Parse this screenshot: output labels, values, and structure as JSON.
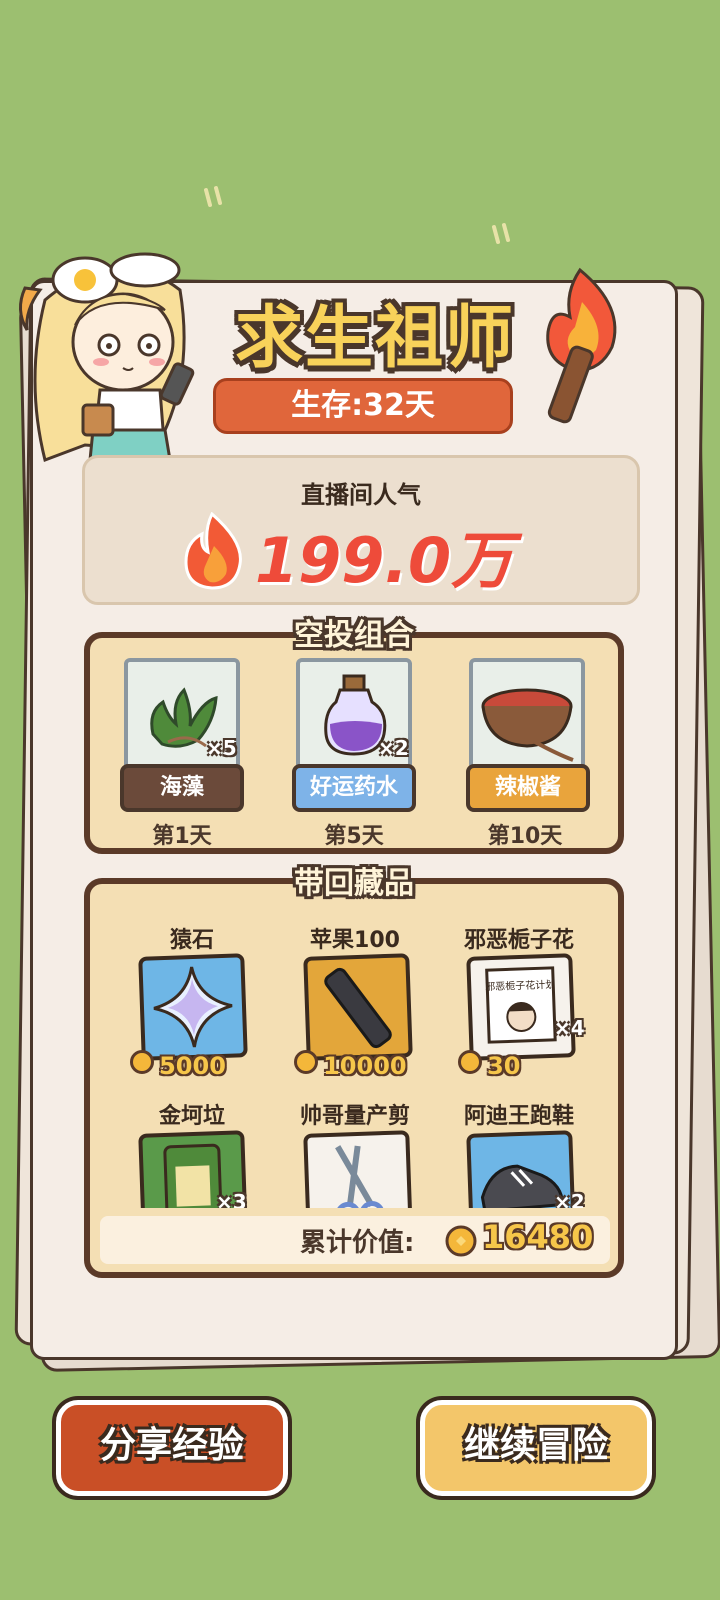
{
  "header": {
    "title": "求生祖师",
    "survival_days": "生存:32天"
  },
  "popularity": {
    "label": "直播间人气",
    "value": "199.0万"
  },
  "airdrop": {
    "title": "空投组合",
    "items": [
      {
        "name": "海藻",
        "qty": "×5",
        "day": "第1天",
        "icon": "seaweed-icon",
        "label_color": "#6b4a3a"
      },
      {
        "name": "好运药水",
        "qty": "×2",
        "day": "第5天",
        "icon": "potion-icon",
        "label_color": "#7eb3e8"
      },
      {
        "name": "辣椒酱",
        "qty": "",
        "day": "第10天",
        "icon": "chili-sauce-icon",
        "label_color": "#e9a43c"
      }
    ]
  },
  "collection": {
    "title": "带回藏品",
    "items": [
      {
        "name": "猿石",
        "price": "5000",
        "qty": "",
        "icon": "star-crystal-icon"
      },
      {
        "name": "苹果100",
        "price": "10000",
        "qty": "",
        "icon": "phone-icon"
      },
      {
        "name": "邪恶栀子花",
        "price": "30",
        "qty": "×4",
        "icon": "book-icon",
        "book_text": "邪恶栀子花计划"
      },
      {
        "name": "金坷垃",
        "price": "",
        "qty": "×3",
        "icon": "fertilizer-bag-icon"
      },
      {
        "name": "帅哥量产剪",
        "price": "",
        "qty": "",
        "icon": "scissors-icon"
      },
      {
        "name": "阿迪王跑鞋",
        "price": "",
        "qty": "×2",
        "icon": "sneaker-icon"
      }
    ],
    "total_label": "累计价值:",
    "total_value": "16480"
  },
  "buttons": {
    "share": "分享经验",
    "continue": "继续冒险"
  },
  "colors": {
    "background": "#9cbf70",
    "share_button": "#c94f26",
    "continue_button": "#f3c66a",
    "popularity_text": "#ee4b3a"
  }
}
